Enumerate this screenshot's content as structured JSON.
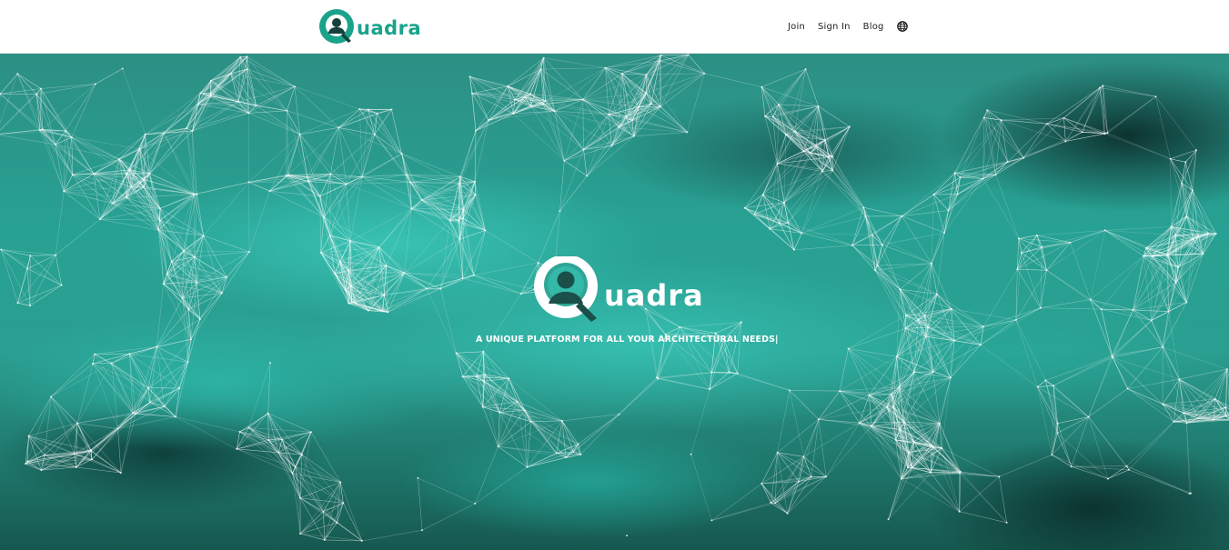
{
  "header": {
    "brand": {
      "icon": "quadra-logo-icon",
      "word": "uadra",
      "color": "#1aa38a"
    },
    "nav": [
      {
        "label": "Join"
      },
      {
        "label": "Sign In"
      },
      {
        "label": "Blog"
      }
    ],
    "language_icon": "globe-icon"
  },
  "hero": {
    "logo": {
      "icon": "quadra-logo-icon",
      "word": "uadra"
    },
    "tagline": "A UNIQUE PLATFORM FOR ALL YOUR ARCHITECTURAL NEEDS|",
    "background": {
      "style": "teal watercolor with white network mesh",
      "accent": "#2fb5a5",
      "dark": "#0d3d39"
    }
  }
}
